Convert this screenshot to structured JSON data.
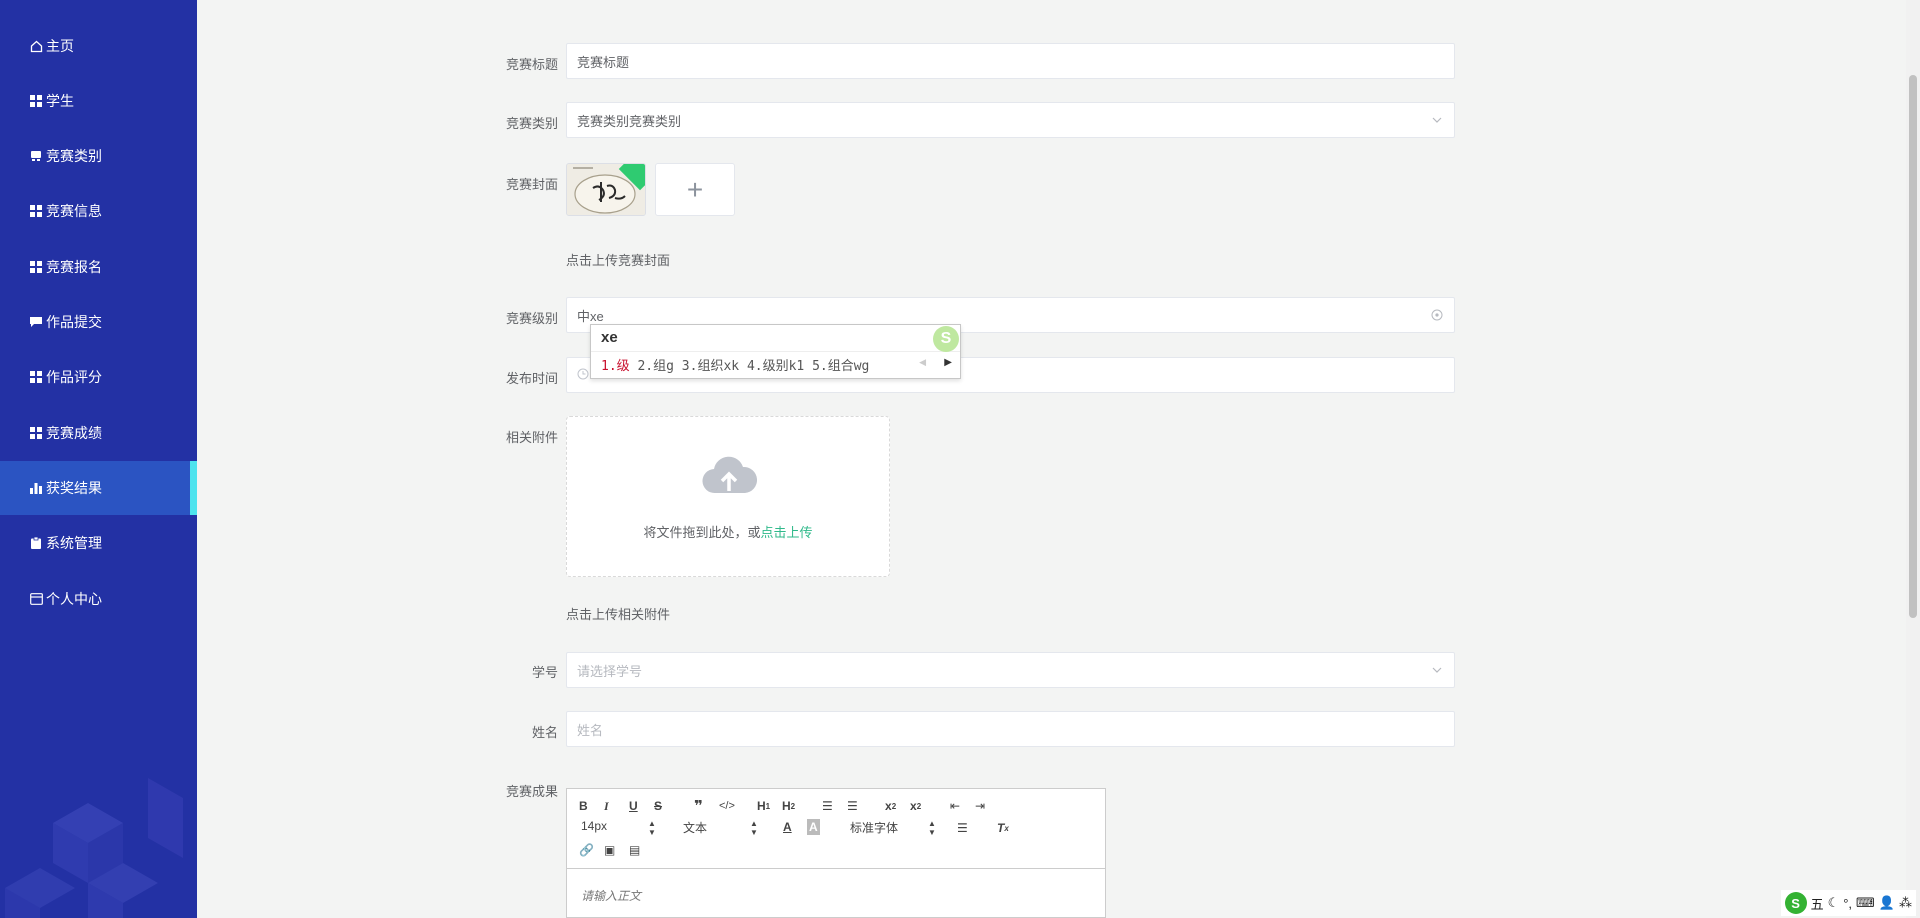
{
  "sidebar": {
    "items": [
      {
        "label": "主页",
        "icon": "home-icon"
      },
      {
        "label": "学生",
        "icon": "grid-icon"
      },
      {
        "label": "竞赛类别",
        "icon": "cart-icon"
      },
      {
        "label": "竞赛信息",
        "icon": "grid-icon"
      },
      {
        "label": "竞赛报名",
        "icon": "grid-icon"
      },
      {
        "label": "作品提交",
        "icon": "comment-icon"
      },
      {
        "label": "作品评分",
        "icon": "grid-icon"
      },
      {
        "label": "竞赛成绩",
        "icon": "grid-icon"
      },
      {
        "label": "获奖结果",
        "icon": "chart-icon"
      },
      {
        "label": "系统管理",
        "icon": "clipboard-icon"
      },
      {
        "label": "个人中心",
        "icon": "card-icon"
      }
    ],
    "active_index": 8
  },
  "form": {
    "title_label": "竞赛标题",
    "title_value": "竞赛标题",
    "category_label": "竞赛类别",
    "category_value": "竞赛类别竞赛类别",
    "cover_label": "竞赛封面",
    "cover_hint": "点击上传竞赛封面",
    "level_label": "竞赛级别",
    "level_value": "中xe",
    "publish_label": "发布时间",
    "attachment_label": "相关附件",
    "upload_text": "将文件拖到此处，或",
    "upload_link": "点击上传",
    "attachment_hint": "点击上传相关附件",
    "student_id_label": "学号",
    "student_id_placeholder": "请选择学号",
    "name_label": "姓名",
    "name_placeholder": "姓名",
    "result_label": "竞赛成果"
  },
  "ime": {
    "composition": "xe",
    "candidates": [
      "1.级",
      "2.组g",
      "3.组织xk",
      "4.级别k1",
      "5.组合wg"
    ]
  },
  "editor": {
    "font_size": "14px",
    "header_select": "文本",
    "font_family": "标准字体",
    "placeholder": "请输入正文"
  },
  "tray": {
    "ime_mode": "五"
  },
  "colors": {
    "sidebar_bg": "#2331a4",
    "sidebar_active": "#2b54c2",
    "active_indicator": "#4de3ee",
    "link": "#2fb98a"
  }
}
